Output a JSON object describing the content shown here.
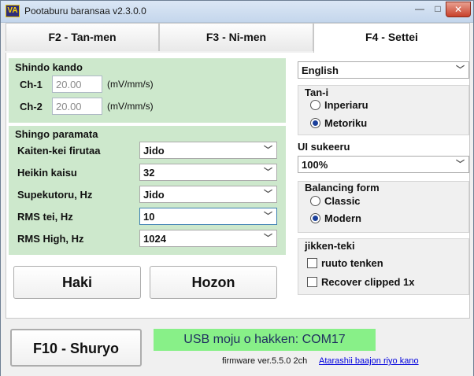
{
  "window": {
    "app_icon_text": "VA",
    "title": "Pootaburu baransaa v2.3.0.0",
    "min_label": "—",
    "max_label": "□",
    "close_label": "✕"
  },
  "tabs": [
    {
      "label": "F2 - Tan-men"
    },
    {
      "label": "F3 - Ni-men"
    },
    {
      "label": "F4 - Settei"
    }
  ],
  "sensitivity": {
    "title": "Shindo kando",
    "rows": [
      {
        "label": "Ch-1",
        "value": "20.00",
        "unit": "(mV/mm/s)"
      },
      {
        "label": "Ch-2",
        "value": "20.00",
        "unit": "(mV/mm/s)"
      }
    ]
  },
  "signal": {
    "title": "Shingo paramata",
    "rows": [
      {
        "label": "Kaiten-kei firutaa",
        "value": "Jido"
      },
      {
        "label": "Heikin kaisu",
        "value": "32"
      },
      {
        "label": "Supekutoru, Hz",
        "value": "Jido"
      },
      {
        "label": "RMS tei, Hz",
        "value": "10"
      },
      {
        "label": "RMS High, Hz",
        "value": "1024"
      }
    ]
  },
  "actions": {
    "discard_label": "Haki",
    "save_label": "Hozon"
  },
  "language": {
    "value": "English"
  },
  "units": {
    "title": "Tan-i",
    "options": [
      {
        "label": "Inperiaru",
        "checked": false
      },
      {
        "label": "Metoriku",
        "checked": true
      }
    ]
  },
  "ui_scale": {
    "title": "UI sukeeru",
    "value": "100%"
  },
  "balancing_form": {
    "title": "Balancing form",
    "options": [
      {
        "label": "Classic",
        "checked": false
      },
      {
        "label": "Modern",
        "checked": true
      }
    ]
  },
  "experimental": {
    "title": "jikken-teki",
    "options": [
      {
        "label": "ruuto tenken",
        "checked": false
      },
      {
        "label": "Recover clipped 1x",
        "checked": false
      }
    ]
  },
  "footer": {
    "exit_label": "F10 - Shuryo",
    "usb_status": "USB moju o hakken: COM17",
    "firmware": "firmware ver.5.5.0 2ch",
    "update_link": "Atarashii baajon riyo kano"
  },
  "icons": {
    "dropdown": "chevron-down-icon",
    "app": "app-logo-icon"
  }
}
